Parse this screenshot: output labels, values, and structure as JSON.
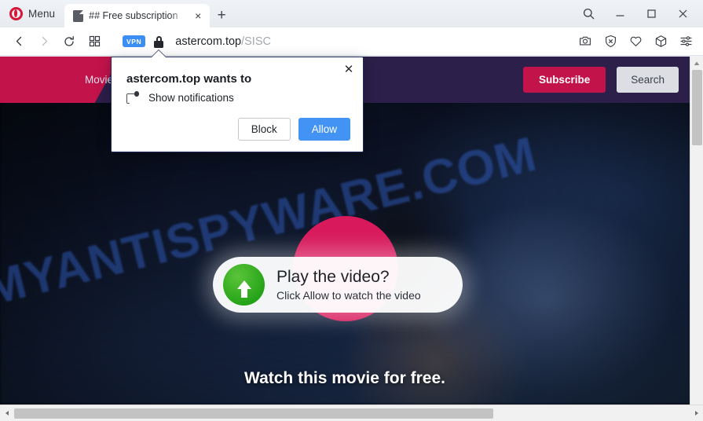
{
  "browser": {
    "menu_label": "Menu",
    "tab": {
      "title": "## Free subscription",
      "close_label": "×",
      "favicon": "page-icon"
    },
    "new_tab_label": "+",
    "window_controls": {
      "search": "search-icon",
      "minimize": "—",
      "maximize": "□",
      "close": "✕"
    },
    "nav": {
      "back": "back-arrow-icon",
      "forward": "forward-arrow-icon",
      "reload": "reload-icon",
      "speed_dial": "speed-dial-icon"
    },
    "address": {
      "vpn_badge": "VPN",
      "lock": "lock-icon",
      "domain": "astercom.top",
      "path": "/SISC"
    },
    "toolbar_icons": [
      {
        "name": "snapshot-icon",
        "glyph": "camera"
      },
      {
        "name": "ad-blocker-icon",
        "glyph": "shield-x"
      },
      {
        "name": "favorites-icon",
        "glyph": "heart"
      },
      {
        "name": "extensions-icon",
        "glyph": "cube"
      },
      {
        "name": "easy-setup-icon",
        "glyph": "sliders"
      }
    ]
  },
  "permission_dialog": {
    "title": "astercom.top wants to",
    "permission_icon": "notification-icon",
    "permission_label": "Show notifications",
    "block_label": "Block",
    "allow_label": "Allow",
    "close_label": "✕",
    "accent_allow": "#4393f5"
  },
  "site": {
    "header": {
      "nav_links": [
        "Movies"
      ],
      "subscribe_label": "Subscribe",
      "search_label": "Search",
      "bg_color": "#2c1f4a",
      "accent_color": "#c2134b"
    },
    "hero": {
      "circle_color": "#d81a5c",
      "play_icon": "up-arrow-icon",
      "play_title": "Play the video?",
      "play_subtitle": "Click Allow to watch the video",
      "tagline": "Watch this movie for free."
    },
    "watermark": "MYANTISPYWARE.COM"
  }
}
